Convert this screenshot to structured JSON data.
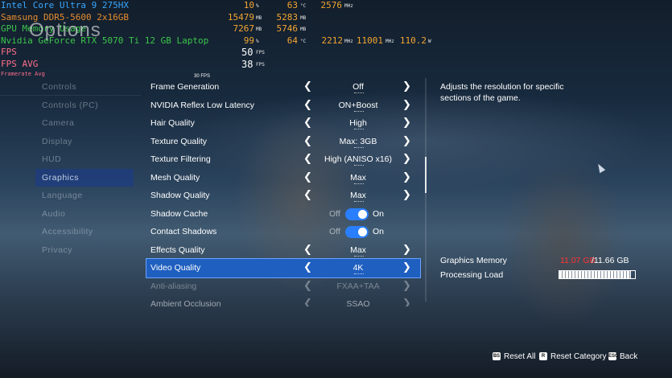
{
  "osd": {
    "cpu": {
      "name": "Intel Core Ultra 9 275HX",
      "load": "10",
      "load_unit": "%",
      "temp": "63",
      "temp_unit": "°C",
      "clock": "2576",
      "clock_unit": "MHz"
    },
    "ram": {
      "name": "Samsung DDR5-5600 2x16GB",
      "used": "15479",
      "used_unit": "MB",
      "avail": "5283",
      "avail_unit": "MB"
    },
    "gpu_mem": {
      "name": "GPU Memory Usage",
      "used": "7267",
      "used_unit": "MB",
      "avail": "5746",
      "avail_unit": "MB"
    },
    "gpu": {
      "name": "Nvidia GeForce RTX 5070 Ti 12 GB Laptop",
      "load": "99",
      "load_unit": "%",
      "temp": "64",
      "temp_unit": "°C",
      "core_clock": "2212",
      "core_unit": "MHz",
      "mem_clock": "11001",
      "mem_unit": "MHz",
      "power": "110.2",
      "power_unit": "W"
    },
    "fps": {
      "name": "FPS",
      "value": "50",
      "unit": "FPS"
    },
    "fps_avg": {
      "name": "FPS AVG",
      "value": "38",
      "unit": "FPS"
    },
    "framerate_label": "Framerate Avg"
  },
  "title": "Options",
  "nav": [
    "Controls",
    "Controls (PC)",
    "Camera",
    "Display",
    "HUD",
    "Graphics",
    "Language",
    "Audio",
    "Accessibility",
    "Privacy"
  ],
  "fps_mini": "30 FPS",
  "settings": [
    {
      "label": "Frame Generation",
      "value": "Off"
    },
    {
      "label": "NVIDIA Reflex Low Latency",
      "value": "ON+Boost"
    },
    {
      "label": "Hair Quality",
      "value": "High"
    },
    {
      "label": "Texture Quality",
      "value": "Max: 3GB"
    },
    {
      "label": "Texture Filtering",
      "value": "High (ANISO x16)"
    },
    {
      "label": "Mesh Quality",
      "value": "Max"
    },
    {
      "label": "Shadow Quality",
      "value": "Max"
    },
    {
      "label": "Shadow Cache",
      "off": "Off",
      "on": "On"
    },
    {
      "label": "Contact Shadows",
      "off": "Off",
      "on": "On"
    },
    {
      "label": "Effects Quality",
      "value": "Max"
    },
    {
      "label": "Video Quality",
      "value": "4K"
    },
    {
      "label": "Anti-aliasing",
      "value": "FXAA+TAA"
    },
    {
      "label": "Ambient Occlusion",
      "value": "SSAO"
    }
  ],
  "description": "Adjusts the resolution for specific sections of the game.",
  "graphics_memory": {
    "label": "Graphics Memory",
    "used": "11.07 GB",
    "total": "/11.66 GB"
  },
  "processing_load": {
    "label": "Processing Load",
    "fraction": 0.95
  },
  "footer": {
    "reset_all": {
      "key": "BS",
      "label": "Reset All"
    },
    "reset_category": {
      "key": "R",
      "label": "Reset Category"
    },
    "back": {
      "key": "ESC",
      "label": "Back"
    }
  }
}
